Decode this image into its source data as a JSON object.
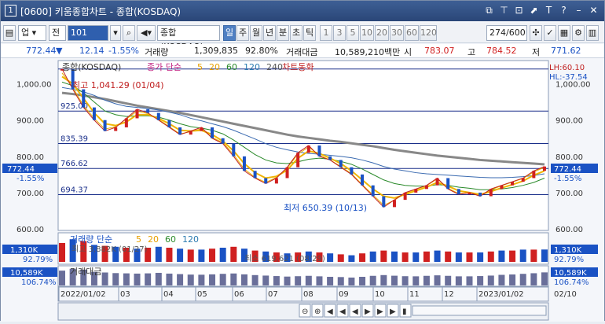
{
  "window": {
    "num": "1",
    "title": "[0600] 키움종합차트 - 종합(KOSDAQ)",
    "icons": [
      "restore-down-icon",
      "pin-icon",
      "fit-window-icon",
      "chart-icon",
      "text-icon",
      "help-icon",
      "minimize-icon",
      "close-icon"
    ]
  },
  "toolbar": {
    "market": "업",
    "category": "전",
    "code": "101",
    "name": "종합(KOSDAQ)",
    "periods": [
      {
        "label": "일",
        "selected": true
      },
      {
        "label": "주",
        "selected": false
      },
      {
        "label": "월",
        "selected": false
      },
      {
        "label": "년",
        "selected": false
      },
      {
        "label": "분",
        "selected": false
      },
      {
        "label": "초",
        "selected": false
      },
      {
        "label": "틱",
        "selected": false
      }
    ],
    "intervals": [
      "1",
      "3",
      "5",
      "10",
      "20",
      "30",
      "60",
      "120"
    ],
    "count": "274/600"
  },
  "info": {
    "price": "772.44",
    "change": "12.14",
    "rate": "-1.55%",
    "volume_label": "거래량",
    "volume": "1,309,835",
    "vol_rate": "92.80%",
    "amount_label": "거래대금",
    "amount": "10,589,210백만",
    "open_label": "시",
    "open": "783.07",
    "high_label": "고",
    "high": "784.52",
    "low_label": "저",
    "low": "771.62"
  },
  "chart": {
    "legend_title": "종합(KOSDAQ)",
    "legend_ma": "종가 단순",
    "ma_periods": [
      "5",
      "20",
      "60",
      "120",
      "240"
    ],
    "sync_label": "차트동화",
    "lh": "LH:60.10",
    "hl": "HL:-37.54",
    "price_ticks": [
      "1,000.00",
      "900.00",
      "800.00",
      "700.00",
      "600.00"
    ],
    "hlines": [
      "925.00",
      "835.39",
      "766.62",
      "694.37"
    ],
    "max_label": "최고 1,041.29 (01/04)",
    "min_label": "최저 650.39 (10/13)",
    "last_price": "772.44",
    "last_rate": "-1.55%",
    "vol_legend": "거래량 단순",
    "vol_ma": [
      "5",
      "20",
      "60",
      "120"
    ],
    "vol_max_text": "최고 3,882K (01/27)",
    "vol_min_text": "최소 619,621 (08/29)",
    "vol_last": "1,310K",
    "vol_last_rate": "92.79%",
    "amt_legend": "거래대금",
    "amt_last": "10,589K",
    "amt_last_rate": "106.74%",
    "x_labels": [
      "2022/01/02",
      "03",
      "04",
      "05",
      "06",
      "07",
      "08",
      "09",
      "10",
      "11",
      "12",
      "2023/01/02"
    ],
    "x_right": "02/10"
  },
  "chart_data": {
    "type": "line",
    "title": "종합(KOSDAQ)",
    "ylim": [
      600,
      1060
    ],
    "series": [
      {
        "name": "종가",
        "values": [
          1041,
          985,
          935,
          900,
          870,
          880,
          905,
          930,
          920,
          900,
          880,
          860,
          870,
          880,
          850,
          835,
          800,
          760,
          740,
          725,
          740,
          770,
          810,
          830,
          800,
          790,
          770,
          750,
          720,
          690,
          660,
          680,
          700,
          710,
          720,
          740,
          710,
          695,
          700,
          690,
          710,
          720,
          730,
          740,
          760,
          772
        ]
      },
      {
        "name": "5",
        "values": [
          1030,
          990,
          940,
          905,
          875,
          882,
          903,
          925,
          918,
          902,
          882,
          862,
          868,
          876,
          852,
          838,
          805,
          765,
          742,
          728,
          742,
          768,
          806,
          826,
          803,
          790,
          772,
          752,
          722,
          694,
          665,
          679,
          698,
          709,
          719,
          738,
          712,
          697,
          699,
          692,
          708,
          719,
          729,
          739,
          757,
          770
        ]
      },
      {
        "name": "20",
        "values": [
          1020,
          1000,
          960,
          920,
          890,
          885,
          895,
          915,
          915,
          905,
          890,
          872,
          870,
          872,
          860,
          842,
          815,
          780,
          755,
          740,
          745,
          762,
          795,
          815,
          808,
          795,
          780,
          760,
          735,
          710,
          690,
          685,
          695,
          705,
          715,
          728,
          718,
          705,
          700,
          695,
          703,
          713,
          722,
          732,
          748,
          760
        ]
      },
      {
        "name": "60",
        "values": [
          1005,
          995,
          975,
          950,
          925,
          915,
          910,
          912,
          912,
          908,
          900,
          890,
          882,
          878,
          872,
          862,
          845,
          825,
          805,
          790,
          782,
          780,
          785,
          792,
          795,
          792,
          786,
          778,
          765,
          750,
          735,
          725,
          720,
          718,
          718,
          722,
          720,
          715,
          712,
          708,
          708,
          710,
          714,
          720,
          728,
          740
        ]
      },
      {
        "name": "120",
        "values": [
          990,
          985,
          978,
          968,
          955,
          945,
          938,
          935,
          932,
          928,
          922,
          915,
          905,
          898,
          890,
          882,
          872,
          860,
          848,
          835,
          825,
          818,
          812,
          808,
          806,
          803,
          800,
          796,
          790,
          782,
          772,
          765,
          760,
          755,
          752,
          750,
          748,
          746,
          744,
          742,
          741,
          741,
          742,
          744,
          747,
          752
        ]
      },
      {
        "name": "240",
        "values": [
          975,
          972,
          968,
          963,
          958,
          952,
          946,
          940,
          935,
          930,
          925,
          920,
          914,
          908,
          902,
          896,
          890,
          884,
          878,
          872,
          866,
          860,
          855,
          851,
          847,
          843,
          840,
          836,
          832,
          828,
          823,
          818,
          814,
          810,
          806,
          802,
          799,
          796,
          793,
          790,
          788,
          786,
          784,
          782,
          780,
          778
        ]
      }
    ],
    "volume": {
      "series_name": "거래량",
      "values": [
        2.0,
        2.4,
        2.2,
        1.8,
        1.7,
        1.6,
        1.5,
        1.4,
        1.5,
        1.6,
        1.5,
        1.4,
        1.3,
        1.3,
        1.4,
        1.5,
        1.6,
        1.4,
        1.2,
        1.1,
        1.0,
        0.9,
        1.0,
        1.1,
        1.0,
        0.9,
        0.8,
        0.7,
        0.9,
        1.1,
        1.2,
        1.1,
        1.0,
        1.0,
        1.1,
        1.2,
        1.1,
        1.0,
        1.0,
        1.0,
        1.1,
        1.2,
        1.2,
        1.3,
        1.3,
        1.31
      ]
    },
    "amount": {
      "series_name": "거래대금",
      "values": [
        12.0,
        13.5,
        12.8,
        11.0,
        10.5,
        10.0,
        9.8,
        9.6,
        9.8,
        10.2,
        9.6,
        9.2,
        8.8,
        8.7,
        9.0,
        9.4,
        9.7,
        9.0,
        8.4,
        8.0,
        7.6,
        7.2,
        7.5,
        7.8,
        7.4,
        7.0,
        6.8,
        6.4,
        7.0,
        7.8,
        8.4,
        7.9,
        7.5,
        7.4,
        7.8,
        8.2,
        7.8,
        7.4,
        7.4,
        7.6,
        8.0,
        8.6,
        8.9,
        9.4,
        9.9,
        10.59
      ]
    }
  }
}
